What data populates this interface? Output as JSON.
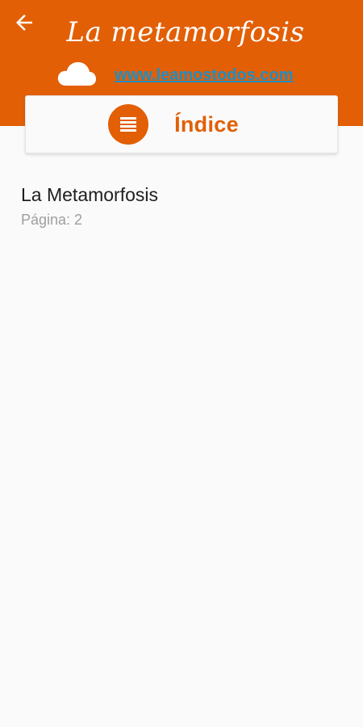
{
  "header": {
    "title": "La metamorfosis",
    "website": "www.leamostodos.com",
    "back_icon": "arrow-left-icon",
    "cloud_icon": "cloud-icon"
  },
  "index_card": {
    "label": "Índice",
    "icon": "list-icon"
  },
  "chapters": [
    {
      "title": "La Metamorfosis",
      "page": "Página: 2"
    }
  ],
  "colors": {
    "primary": "#e25f05",
    "link": "#1f8ec4",
    "background": "#fafafa",
    "text": "#1e1e1e",
    "subtext": "#9e9e9e"
  }
}
